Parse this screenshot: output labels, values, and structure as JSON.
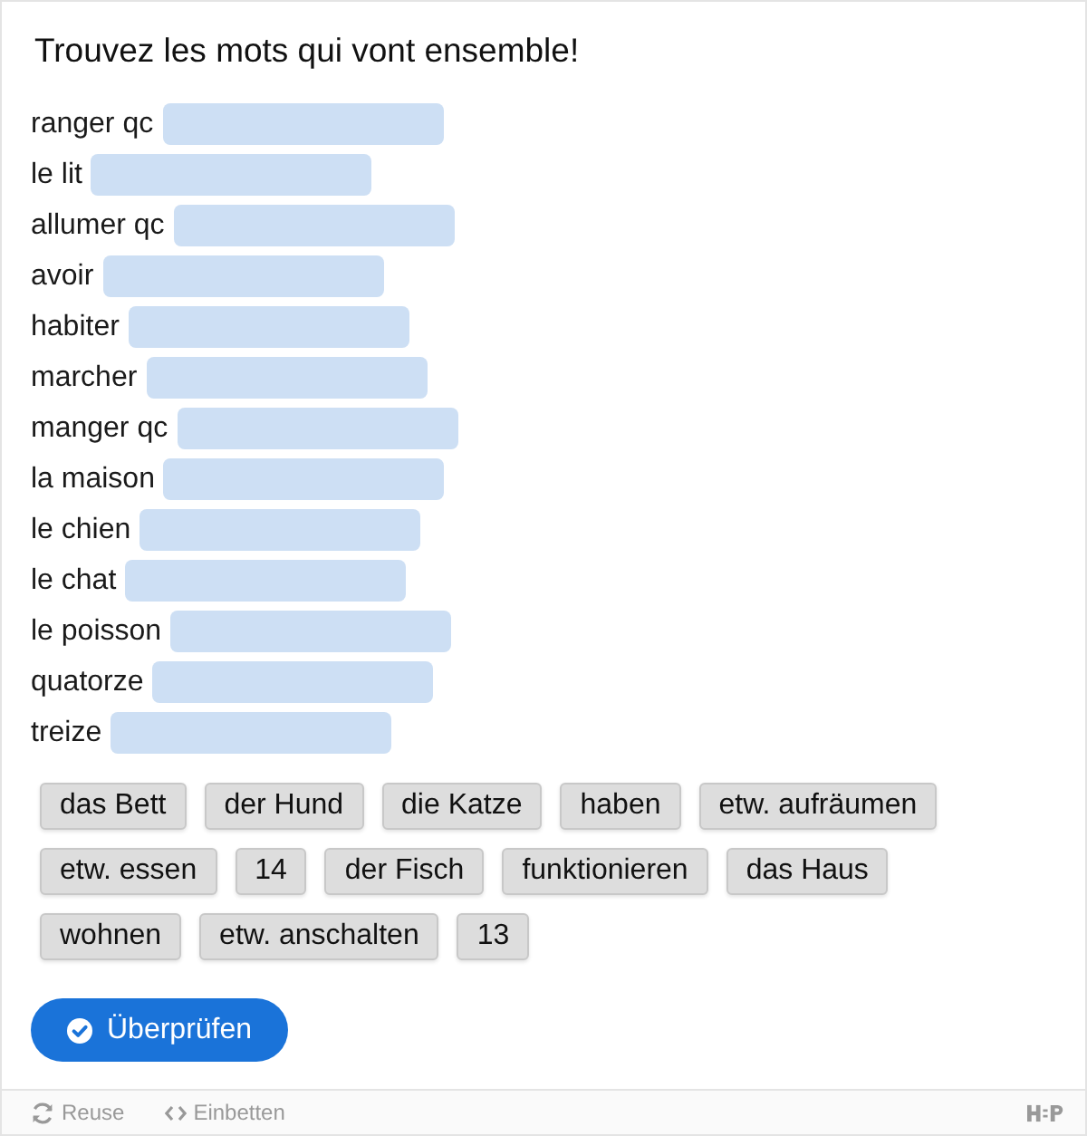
{
  "title": "Trouvez les mots qui vont ensemble!",
  "prompts": [
    {
      "label": "ranger qc"
    },
    {
      "label": "le lit"
    },
    {
      "label": "allumer qc"
    },
    {
      "label": "avoir"
    },
    {
      "label": "habiter"
    },
    {
      "label": "marcher"
    },
    {
      "label": "manger qc"
    },
    {
      "label": "la maison"
    },
    {
      "label": "le chien"
    },
    {
      "label": "le chat"
    },
    {
      "label": "le poisson"
    },
    {
      "label": "quatorze"
    },
    {
      "label": "treize"
    }
  ],
  "words": [
    "das Bett",
    "der Hund",
    "die Katze",
    "haben",
    "etw. aufräumen",
    "etw. essen",
    "14",
    "der Fisch",
    "funktionieren",
    "das Haus",
    "wohnen",
    "etw. anschalten",
    "13"
  ],
  "check_button": {
    "label": "Überprüfen"
  },
  "footer": {
    "links": [
      {
        "kind": "reuse",
        "label": "Reuse"
      },
      {
        "kind": "embed",
        "label": "Einbetten"
      }
    ]
  }
}
